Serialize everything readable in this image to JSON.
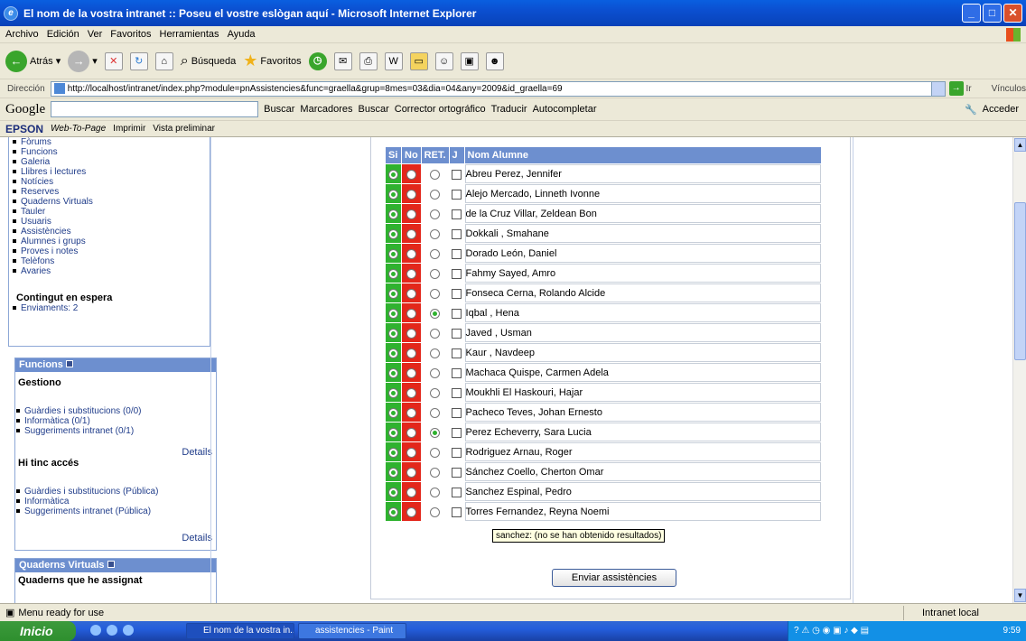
{
  "window": {
    "title": "El nom de la vostra intranet :: Poseu el vostre eslògan aquí - Microsoft Internet Explorer"
  },
  "menu": [
    "Archivo",
    "Edición",
    "Ver",
    "Favoritos",
    "Herramientas",
    "Ayuda"
  ],
  "toolbar": {
    "back": "Atrás",
    "search": "Búsqueda",
    "favorites": "Favoritos"
  },
  "address": {
    "label": "Dirección",
    "url": "http://localhost/intranet/index.php?module=pnAssistencies&func=graella&grup=8mes=03&dia=04&any=2009&id_graella=69",
    "go": "Ir",
    "links": "Vínculos"
  },
  "googlebar": {
    "logo": "Google",
    "search": "Buscar",
    "bookmarks": "Marcadores",
    "find": "Buscar",
    "spell": "Corrector ortográfico",
    "translate": "Traducir",
    "autofill": "Autocompletar",
    "signin": "Acceder"
  },
  "epsonbar": {
    "brand": "EPSON",
    "webtopage": "Web-To-Page",
    "print": "Imprimir",
    "preview": "Vista preliminar"
  },
  "sidebar": {
    "menu_items": [
      "Fòrums",
      "Funcions",
      "Galeria",
      "Llibres i lectures",
      "Notícies",
      "Reserves",
      "Quaderns Virtuals",
      "Tauler",
      "Usuaris",
      "Assistències",
      "Alumnes i grups",
      "Proves i notes",
      "Telèfons",
      "Avaries"
    ],
    "pending_title": "Contingut en espera",
    "pending_item": "Enviaments: 2",
    "funcions": {
      "title": "Funcions",
      "manage_title": "Gestiono",
      "manage_items": [
        "Guàrdies i substitucions (0/0)",
        "Informàtica (0/1)",
        "Suggeriments intranet (0/1)"
      ],
      "details": "Details",
      "access_title": "Hi tinc accés",
      "access_items": [
        "Guàrdies i substitucions (Pública)",
        "Informàtica",
        "Suggeriments intranet (Pública)"
      ],
      "details2": "Details"
    },
    "quaderns": {
      "title": "Quaderns Virtuals",
      "subtitle": "Quaderns que he assignat"
    }
  },
  "attendance": {
    "headers": {
      "si": "Si",
      "no": "No",
      "ret": "RET.",
      "j": "J",
      "name": "Nom Alumne"
    },
    "rows": [
      {
        "name": "Abreu Perez, Jennifer",
        "ret": false
      },
      {
        "name": "Alejo Mercado, Linneth Ivonne",
        "ret": false
      },
      {
        "name": "de la Cruz Villar, Zeldean Bon",
        "ret": false
      },
      {
        "name": "Dokkali , Smahane",
        "ret": false
      },
      {
        "name": "Dorado León, Daniel",
        "ret": false
      },
      {
        "name": "Fahmy Sayed, Amro",
        "ret": false
      },
      {
        "name": "Fonseca Cerna, Rolando Alcide",
        "ret": false
      },
      {
        "name": "Iqbal , Hena",
        "ret": true
      },
      {
        "name": "Javed , Usman",
        "ret": false
      },
      {
        "name": "Kaur , Navdeep",
        "ret": false
      },
      {
        "name": "Machaca Quispe, Carmen Adela",
        "ret": false
      },
      {
        "name": "Moukhli El Haskouri, Hajar",
        "ret": false
      },
      {
        "name": "Pacheco Teves, Johan Ernesto",
        "ret": false
      },
      {
        "name": "Perez Echeverry, Sara Lucia",
        "ret": true
      },
      {
        "name": "Rodriguez Arnau, Roger",
        "ret": false
      },
      {
        "name": "Sánchez Coello, Cherton Omar",
        "ret": false
      },
      {
        "name": "Sanchez Espinal, Pedro",
        "ret": false
      },
      {
        "name": "Torres Fernandez, Reyna Noemi",
        "ret": false
      }
    ],
    "tooltip": "sanchez: (no se han obtenido resultados)",
    "submit": "Enviar assistències"
  },
  "status": {
    "text": "Menu ready for use",
    "zone": "Intranet local"
  },
  "taskbar": {
    "start": "Inicio",
    "tasks": [
      "El nom de la vostra in...",
      "assistencies - Paint"
    ],
    "clock": "9:59"
  }
}
